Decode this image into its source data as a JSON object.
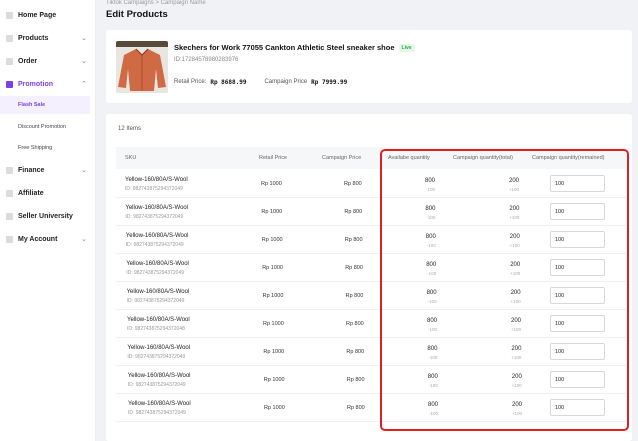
{
  "breadcrumb": "Tiktok Campaigns  >  Campaign Name",
  "page_title": "Edit Products",
  "sidebar": {
    "items": [
      {
        "label": "Home Page",
        "chevron": ""
      },
      {
        "label": "Products",
        "chevron": "⌄"
      },
      {
        "label": "Order",
        "chevron": "⌄"
      },
      {
        "label": "Promotion",
        "chevron": "⌃"
      },
      {
        "label": "Finance",
        "chevron": "⌄"
      },
      {
        "label": "Affiliate",
        "chevron": ""
      },
      {
        "label": "Seller University",
        "chevron": ""
      },
      {
        "label": "My Account",
        "chevron": "⌄"
      }
    ],
    "sub_items": [
      {
        "label": "Flash Sale"
      },
      {
        "label": "Discount Promotion"
      },
      {
        "label": "Free Shipping"
      }
    ],
    "accent_color": "#7b3fe4"
  },
  "product": {
    "name": "Skechers for Work 77055 Cankton Athletic Steel sneaker shoe",
    "badge": "Live",
    "id_text": "ID:17284578980283976",
    "retail_label": "Retail Price:",
    "retail_value": "Rp 8688.99",
    "campaign_label": "Campaign Price",
    "campaign_value": "Rp 7999.99"
  },
  "items_count": "12 Items",
  "table": {
    "headers": [
      "SKU",
      "Retail Price",
      "Campaign Price",
      "Availabe quantity",
      "Campaign quantity(total)",
      "Campaign quantity(remained)"
    ],
    "rows": [
      {
        "sku": "Yellow-160/80A/S-Wool",
        "sku_id": "ID: 982743875294372049",
        "retail": "Rp 1000",
        "campaign": "Rp 800",
        "avail": "800",
        "avail_sub": "-100",
        "total": "200",
        "total_sub": "+100",
        "remained": "100"
      },
      {
        "sku": "Yellow-160/80A/S-Wool",
        "sku_id": "ID: 982743875294372049",
        "retail": "Rp 1000",
        "campaign": "Rp 800",
        "avail": "800",
        "avail_sub": "-100",
        "total": "200",
        "total_sub": "+100",
        "remained": "100"
      },
      {
        "sku": "Yellow-160/80A/S-Wool",
        "sku_id": "ID: 982743875294372049",
        "retail": "Rp 1000",
        "campaign": "Rp 800",
        "avail": "800",
        "avail_sub": "-100",
        "total": "200",
        "total_sub": "+100",
        "remained": "100"
      },
      {
        "sku": "Yellow-160/80A/S-Wool",
        "sku_id": "ID: 982743875294372049",
        "retail": "Rp 1000",
        "campaign": "Rp 800",
        "avail": "800",
        "avail_sub": "-100",
        "total": "200",
        "total_sub": "+100",
        "remained": "100"
      },
      {
        "sku": "Yellow-160/80A/S-Wool",
        "sku_id": "ID: 982743875294372049",
        "retail": "Rp 1000",
        "campaign": "Rp 800",
        "avail": "800",
        "avail_sub": "-100",
        "total": "200",
        "total_sub": "+100",
        "remained": "100"
      },
      {
        "sku": "Yellow-160/80A/S-Wool",
        "sku_id": "ID: 982743875294372048",
        "retail": "Rp 1000",
        "campaign": "Rp 800",
        "avail": "800",
        "avail_sub": "-100",
        "total": "200",
        "total_sub": "+100",
        "remained": "100"
      },
      {
        "sku": "Yellow-160/80A/S-Wool",
        "sku_id": "ID: 982743875294372049",
        "retail": "Rp 1000",
        "campaign": "Rp 800",
        "avail": "800",
        "avail_sub": "-100",
        "total": "200",
        "total_sub": "+100",
        "remained": "100"
      },
      {
        "sku": "Yellow-160/80A/S-Wool",
        "sku_id": "ID: 982743875294372049",
        "retail": "Rp 1000",
        "campaign": "Rp 800",
        "avail": "800",
        "avail_sub": "-100",
        "total": "200",
        "total_sub": "+100",
        "remained": "100"
      },
      {
        "sku": "Yellow-160/80A/S-Wool",
        "sku_id": "ID: 982743875294372049",
        "retail": "Rp 1000",
        "campaign": "Rp 800",
        "avail": "800",
        "avail_sub": "-100",
        "total": "200",
        "total_sub": "+100",
        "remained": "100"
      }
    ]
  },
  "highlight_color": "#e02020"
}
